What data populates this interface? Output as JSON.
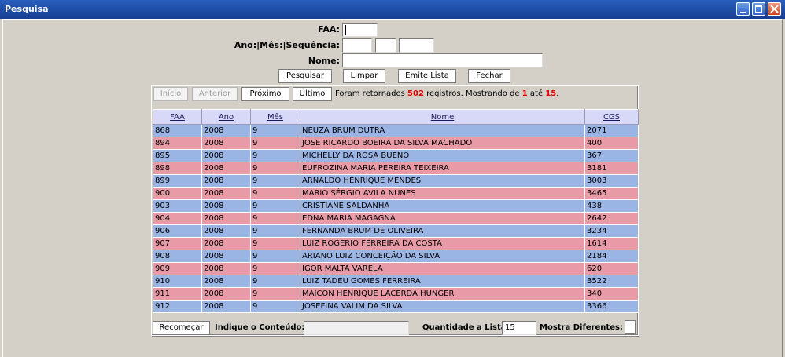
{
  "window": {
    "title": "Pesquisa"
  },
  "form": {
    "faa_label": "FAA:",
    "faa_value": "",
    "ano_mes_seq_label": "Ano:|Mês:|Sequência:",
    "ano_value": "",
    "mes_value": "",
    "seq_value": "",
    "nome_label": "Nome:",
    "nome_value": ""
  },
  "actions": {
    "pesquisar": "Pesquisar",
    "limpar": "Limpar",
    "emite_lista": "Emite Lista",
    "fechar": "Fechar"
  },
  "nav": {
    "inicio": "Início",
    "anterior": "Anterior",
    "proximo": "Próximo",
    "ultimo": "Último",
    "status_prefix": "Foram retornados",
    "total": "502",
    "status_mid": "registros. Mostrando de",
    "from": "1",
    "status_ate": "até",
    "to": "15",
    "status_end": "."
  },
  "table": {
    "headers": [
      "FAA",
      "Ano",
      "Mês",
      "Nome",
      "CGS"
    ],
    "rows": [
      {
        "faa": "868",
        "ano": "2008",
        "mes": "9",
        "nome": "NEUZA BRUM DUTRA",
        "cgs": "2071",
        "color": "blue"
      },
      {
        "faa": "894",
        "ano": "2008",
        "mes": "9",
        "nome": "JOSE RICARDO BOEIRA DA SILVA MACHADO",
        "cgs": "400",
        "color": "pink"
      },
      {
        "faa": "895",
        "ano": "2008",
        "mes": "9",
        "nome": "MICHELLY DA ROSA BUENO",
        "cgs": "367",
        "color": "blue"
      },
      {
        "faa": "898",
        "ano": "2008",
        "mes": "9",
        "nome": "EUFROZINA MARIA PEREIRA TEIXEIRA",
        "cgs": "3181",
        "color": "pink"
      },
      {
        "faa": "899",
        "ano": "2008",
        "mes": "9",
        "nome": "ARNALDO HENRIQUE MENDES",
        "cgs": "3003",
        "color": "blue"
      },
      {
        "faa": "900",
        "ano": "2008",
        "mes": "9",
        "nome": "MARIO SÉRGIO AVILA NUNES",
        "cgs": "3465",
        "color": "pink"
      },
      {
        "faa": "903",
        "ano": "2008",
        "mes": "9",
        "nome": "CRISTIANE SALDANHA",
        "cgs": "438",
        "color": "blue"
      },
      {
        "faa": "904",
        "ano": "2008",
        "mes": "9",
        "nome": "EDNA MARIA MAGAGNA",
        "cgs": "2642",
        "color": "pink"
      },
      {
        "faa": "906",
        "ano": "2008",
        "mes": "9",
        "nome": "FERNANDA BRUM DE OLIVEIRA",
        "cgs": "3234",
        "color": "blue"
      },
      {
        "faa": "907",
        "ano": "2008",
        "mes": "9",
        "nome": "LUIZ ROGERIO FERREIRA DA COSTA",
        "cgs": "1614",
        "color": "pink"
      },
      {
        "faa": "908",
        "ano": "2008",
        "mes": "9",
        "nome": "ARIANO LUIZ CONCEIÇÃO DA SILVA",
        "cgs": "2184",
        "color": "blue"
      },
      {
        "faa": "909",
        "ano": "2008",
        "mes": "9",
        "nome": "IGOR MALTA VARELA",
        "cgs": "620",
        "color": "pink"
      },
      {
        "faa": "910",
        "ano": "2008",
        "mes": "9",
        "nome": "LUIZ TADEU GOMES FERREIRA",
        "cgs": "3522",
        "color": "blue"
      },
      {
        "faa": "911",
        "ano": "2008",
        "mes": "9",
        "nome": "MAICON HENRIQUE LACERDA HUNGER",
        "cgs": "340",
        "color": "pink"
      },
      {
        "faa": "912",
        "ano": "2008",
        "mes": "9",
        "nome": "JOSEFINA VALIM DA SILVA",
        "cgs": "3366",
        "color": "blue"
      }
    ]
  },
  "footer": {
    "recomecar": "Recomeçar",
    "indique_label": "Indique o Conteúdo:",
    "indique_value": "",
    "quantidade_label": "Quantidade a Listar:",
    "quantidade_value": "15",
    "mostra_label": "Mostra Diferentes:"
  },
  "colors": {
    "row_blue": "#9ab4e4",
    "row_pink": "#e89aa6",
    "header_bg": "#d8d8f8",
    "highlight_red": "#e00000",
    "titlebar": "#1f4ea8"
  },
  "icons": {
    "minimize": "minimize-icon",
    "maximize": "maximize-icon",
    "close": "close-icon"
  }
}
